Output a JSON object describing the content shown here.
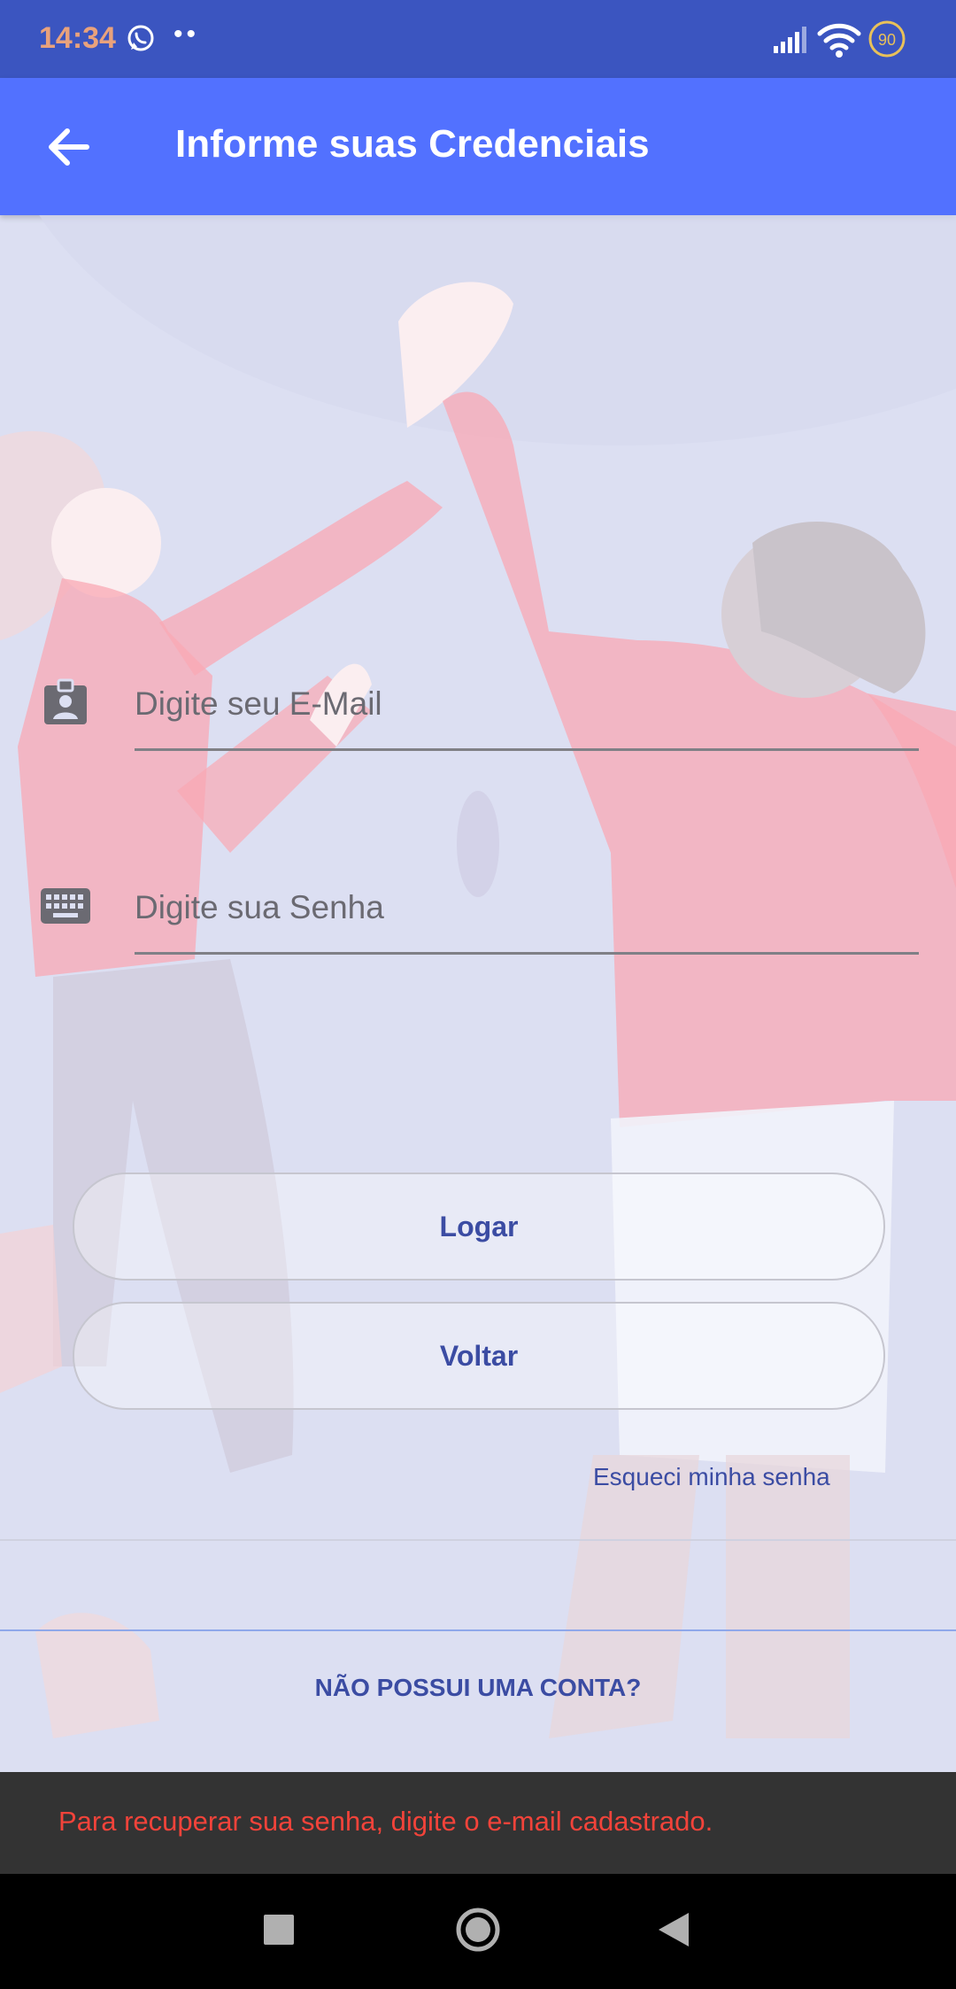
{
  "status_bar": {
    "time": "14:34",
    "notification_dots": "••",
    "battery_level": "90",
    "icons": [
      "whatsapp-icon",
      "signal-icon",
      "wifi-icon",
      "battery-icon"
    ]
  },
  "app_bar": {
    "title": "Informe suas Credenciais",
    "back_icon": "arrow-back-icon",
    "background": "#5271ff"
  },
  "form": {
    "email": {
      "placeholder": "Digite seu E-Mail",
      "value": "",
      "icon": "contact-badge-icon"
    },
    "password": {
      "placeholder": "Digite sua Senha",
      "value": "",
      "icon": "keyboard-icon"
    }
  },
  "buttons": {
    "login_label": "Logar",
    "back_label": "Voltar"
  },
  "links": {
    "forgot_password": "Esqueci minha senha",
    "no_account": "NÃO POSSUI UMA CONTA?"
  },
  "snackbar": {
    "message": "Para recuperar sua senha, digite o e-mail cadastrado.",
    "color": "#f2433a"
  },
  "nav_bar": {
    "icons": [
      "recents-square-icon",
      "home-circle-icon",
      "back-triangle-icon"
    ]
  }
}
